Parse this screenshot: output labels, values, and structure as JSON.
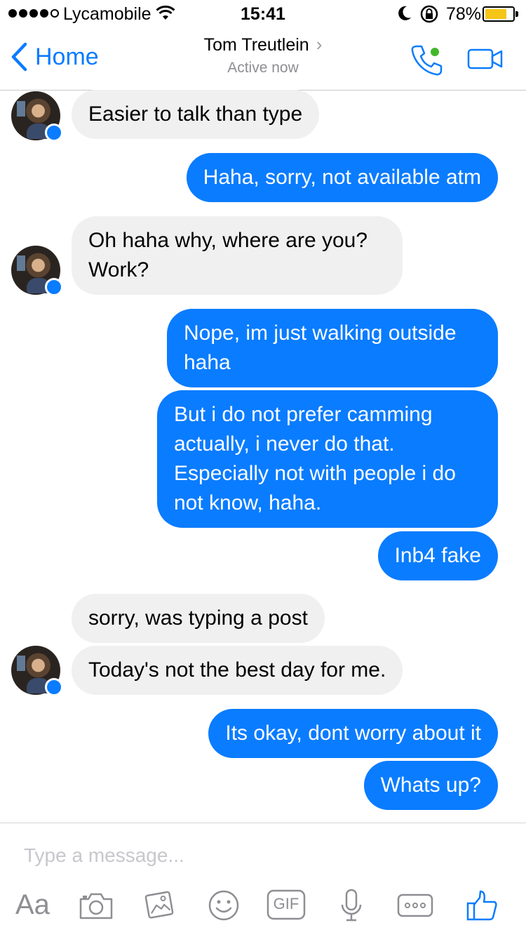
{
  "status_bar": {
    "carrier": "Lycamobile",
    "time": "15:41",
    "battery_percent": "78%",
    "battery_level": 0.78,
    "signal_bars": 4,
    "battery_color": "#f5c518"
  },
  "header": {
    "back_label": "Home",
    "contact_name": "Tom Treutlein",
    "status": "Active now",
    "online_color": "#42b72a"
  },
  "messages": [
    {
      "direction": "in",
      "text": "Easier to talk than type"
    },
    {
      "direction": "out",
      "text": "Haha, sorry, not available atm"
    },
    {
      "direction": "in",
      "text": "Oh haha why, where are you? Work?"
    },
    {
      "direction": "out",
      "text": "Nope, im just walking outside haha"
    },
    {
      "direction": "out",
      "text": "But i do not prefer camming actually, i never do that. Especially not with people i do not know, haha."
    },
    {
      "direction": "out",
      "text": "Inb4 fake"
    },
    {
      "direction": "in",
      "text": "sorry, was typing a post"
    },
    {
      "direction": "in",
      "text": "Today's not the best day for me."
    },
    {
      "direction": "out",
      "text": "Its okay, dont worry about it"
    },
    {
      "direction": "out",
      "text": "Whats up?"
    }
  ],
  "composer": {
    "placeholder": "Type a message...",
    "aa_label": "Aa",
    "gif_label": "GIF",
    "tools": [
      "camera-icon",
      "gallery-icon",
      "emoji-icon",
      "gif-icon",
      "microphone-icon",
      "more-icon",
      "like-icon"
    ]
  },
  "colors": {
    "accent": "#0a7cff",
    "incoming_bubble": "#f1f0f0",
    "outgoing_bubble": "#0a7cff"
  }
}
